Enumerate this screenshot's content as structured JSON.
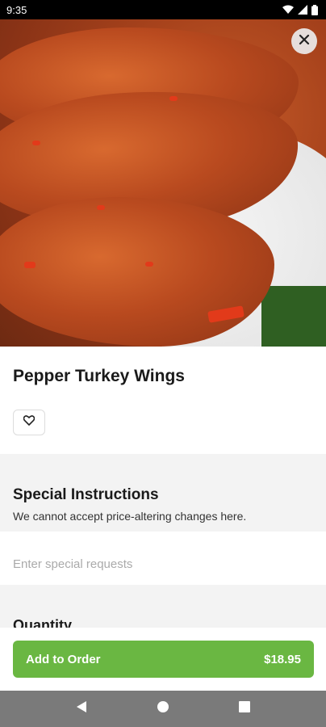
{
  "status_bar": {
    "time": "9:35"
  },
  "item": {
    "name": "Pepper Turkey Wings"
  },
  "special_instructions": {
    "title": "Special Instructions",
    "description": "We cannot accept price-altering changes here.",
    "placeholder": "Enter special requests"
  },
  "quantity": {
    "title": "Quantity"
  },
  "footer": {
    "add_label": "Add to Order",
    "price": "$18.95"
  },
  "colors": {
    "accent": "#6ab742",
    "nav_bar": "#7a7a7a"
  },
  "icons": [
    "wifi-icon",
    "signal-icon",
    "battery-icon",
    "close-icon",
    "heart-icon",
    "back-icon",
    "home-icon",
    "recents-icon"
  ]
}
